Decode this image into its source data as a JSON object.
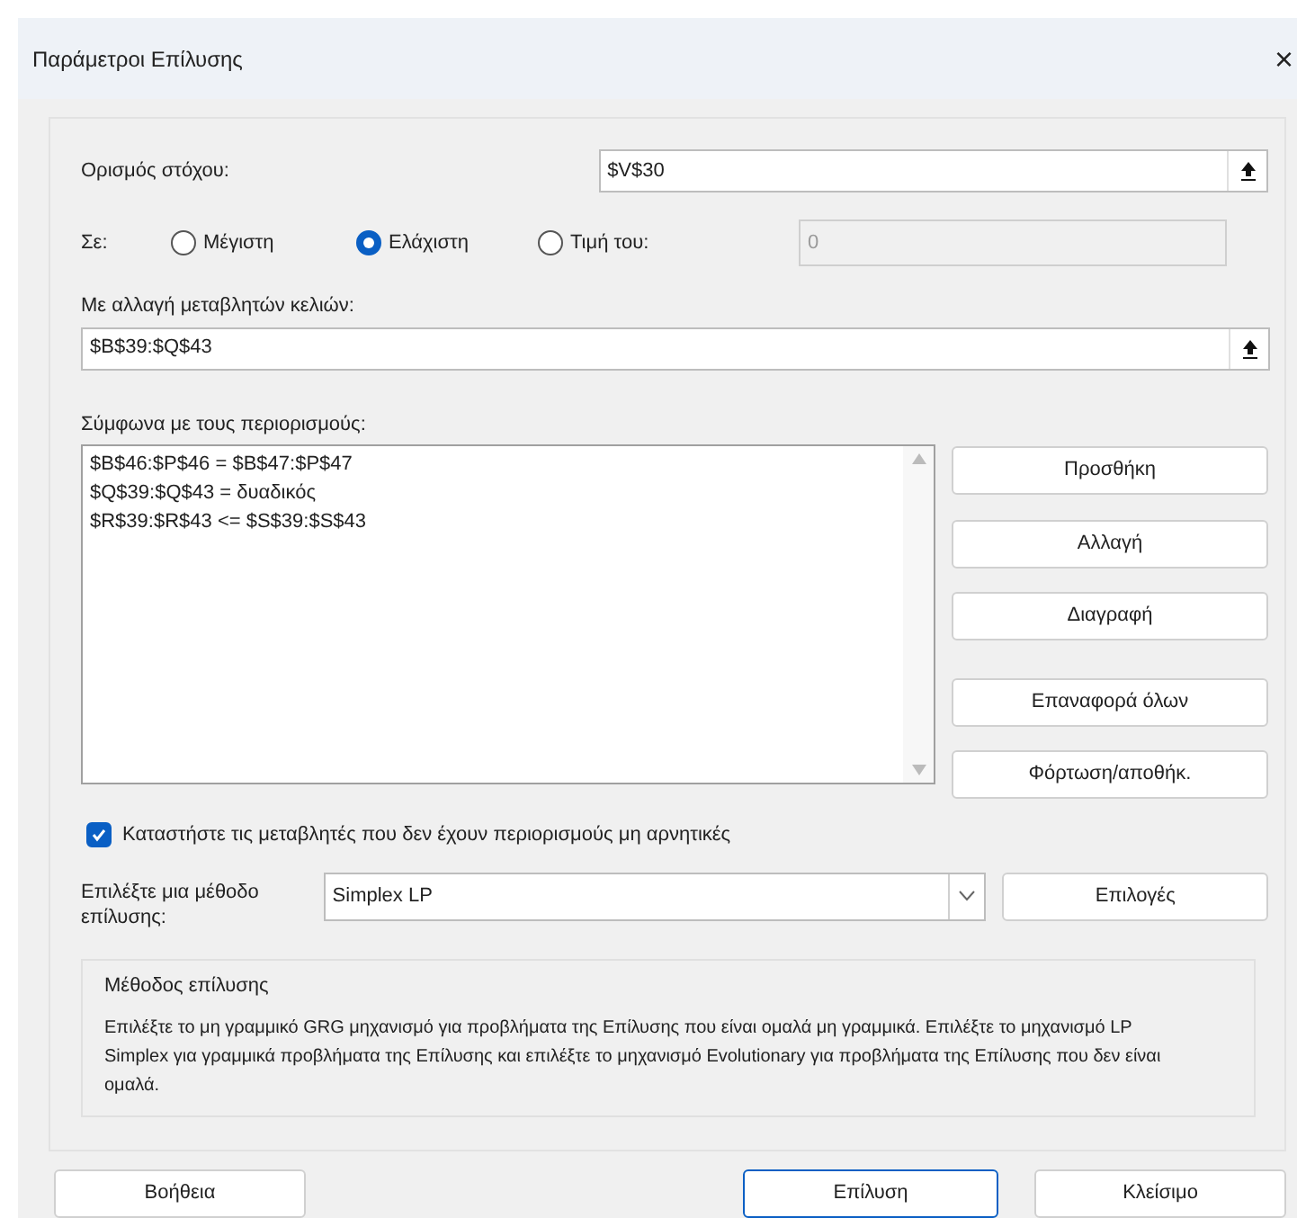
{
  "window": {
    "title": "Παράμετροι Επίλυσης",
    "close": "×"
  },
  "objective": {
    "label": "Ορισμός στόχου:",
    "value": "$V$30"
  },
  "to": {
    "label": "Σε:",
    "options": [
      {
        "label": "Μέγιστη",
        "selected": false
      },
      {
        "label": "Ελάχιστη",
        "selected": true
      },
      {
        "label": "Τιμή του:",
        "selected": false
      }
    ],
    "value_field": {
      "value": "0",
      "disabled": true
    }
  },
  "variables": {
    "label": "Με αλλαγή μεταβλητών κελιών:",
    "value": "$B$39:$Q$43"
  },
  "constraints": {
    "label": "Σύμφωνα με τους περιορισμούς:",
    "items": [
      "$B$46:$P$46 = $B$47:$P$47",
      "$Q$39:$Q$43 = δυαδικός",
      "$R$39:$R$43 <= $S$39:$S$43"
    ],
    "buttons": [
      "Προσθήκη",
      "Αλλαγή",
      "Διαγραφή",
      "Επαναφορά όλων",
      "Φόρτωση/αποθήκ."
    ]
  },
  "nonnegative": {
    "label": "Καταστήστε τις μεταβλητές που δεν έχουν περιορισμούς μη αρνητικές",
    "checked": true
  },
  "method": {
    "label": "Επιλέξτε μια μέθοδο επίλυσης:",
    "value": "Simplex LP",
    "options_button": "Επιλογές"
  },
  "method_info": {
    "title": "Μέθοδος επίλυσης",
    "text": "Επιλέξτε το μη γραμμικό GRG μηχανισμό για προβλήματα της Επίλυσης που είναι ομαλά μη γραμμικά. Επιλέξτε το μηχανισμό LP Simplex για γραμμικά προβλήματα της Επίλυσης και επιλέξτε το μηχανισμό Evolutionary για προβλήματα της Επίλυσης που δεν είναι ομαλά."
  },
  "footer_buttons": [
    {
      "label": "Βοήθεια",
      "default": false
    },
    {
      "label": "Επίλυση",
      "default": true
    },
    {
      "label": "Κλείσιμο",
      "default": false
    }
  ]
}
